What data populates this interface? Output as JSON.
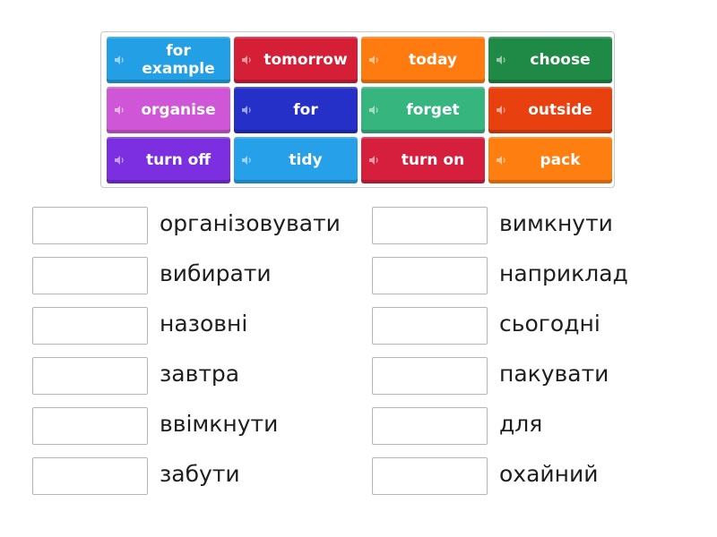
{
  "tiles": [
    {
      "label": "for example",
      "color": "#239fe6",
      "icon": "speaker-icon"
    },
    {
      "label": "tomorrow",
      "color": "#d41f36",
      "icon": "speaker-icon"
    },
    {
      "label": "today",
      "color": "#ff7a0f",
      "icon": "speaker-icon"
    },
    {
      "label": "choose",
      "color": "#1f8a45",
      "icon": "speaker-icon"
    },
    {
      "label": "organise",
      "color": "#cf56d6",
      "icon": "speaker-icon"
    },
    {
      "label": "for",
      "color": "#2430c7",
      "icon": "speaker-icon"
    },
    {
      "label": "forget",
      "color": "#36b57f",
      "icon": "speaker-icon"
    },
    {
      "label": "outside",
      "color": "#e8400e",
      "icon": "speaker-icon"
    },
    {
      "label": "turn off",
      "color": "#7b2fe0",
      "icon": "speaker-icon"
    },
    {
      "label": "tidy",
      "color": "#27a0ea",
      "icon": "speaker-icon"
    },
    {
      "label": "turn on",
      "color": "#d61f3d",
      "icon": "speaker-icon"
    },
    {
      "label": "pack",
      "color": "#ff7e10",
      "icon": "speaker-icon"
    }
  ],
  "targets": [
    {
      "word": "організовувати",
      "slot": ""
    },
    {
      "word": "вимкнути",
      "slot": ""
    },
    {
      "word": "вибирати",
      "slot": ""
    },
    {
      "word": "наприклад",
      "slot": ""
    },
    {
      "word": "назовні",
      "slot": ""
    },
    {
      "word": "сьогодні",
      "slot": ""
    },
    {
      "word": "завтра",
      "slot": ""
    },
    {
      "word": "пакувати",
      "slot": ""
    },
    {
      "word": "ввімкнути",
      "slot": ""
    },
    {
      "word": "для",
      "slot": ""
    },
    {
      "word": "забути",
      "slot": ""
    },
    {
      "word": "охайний",
      "slot": ""
    }
  ]
}
